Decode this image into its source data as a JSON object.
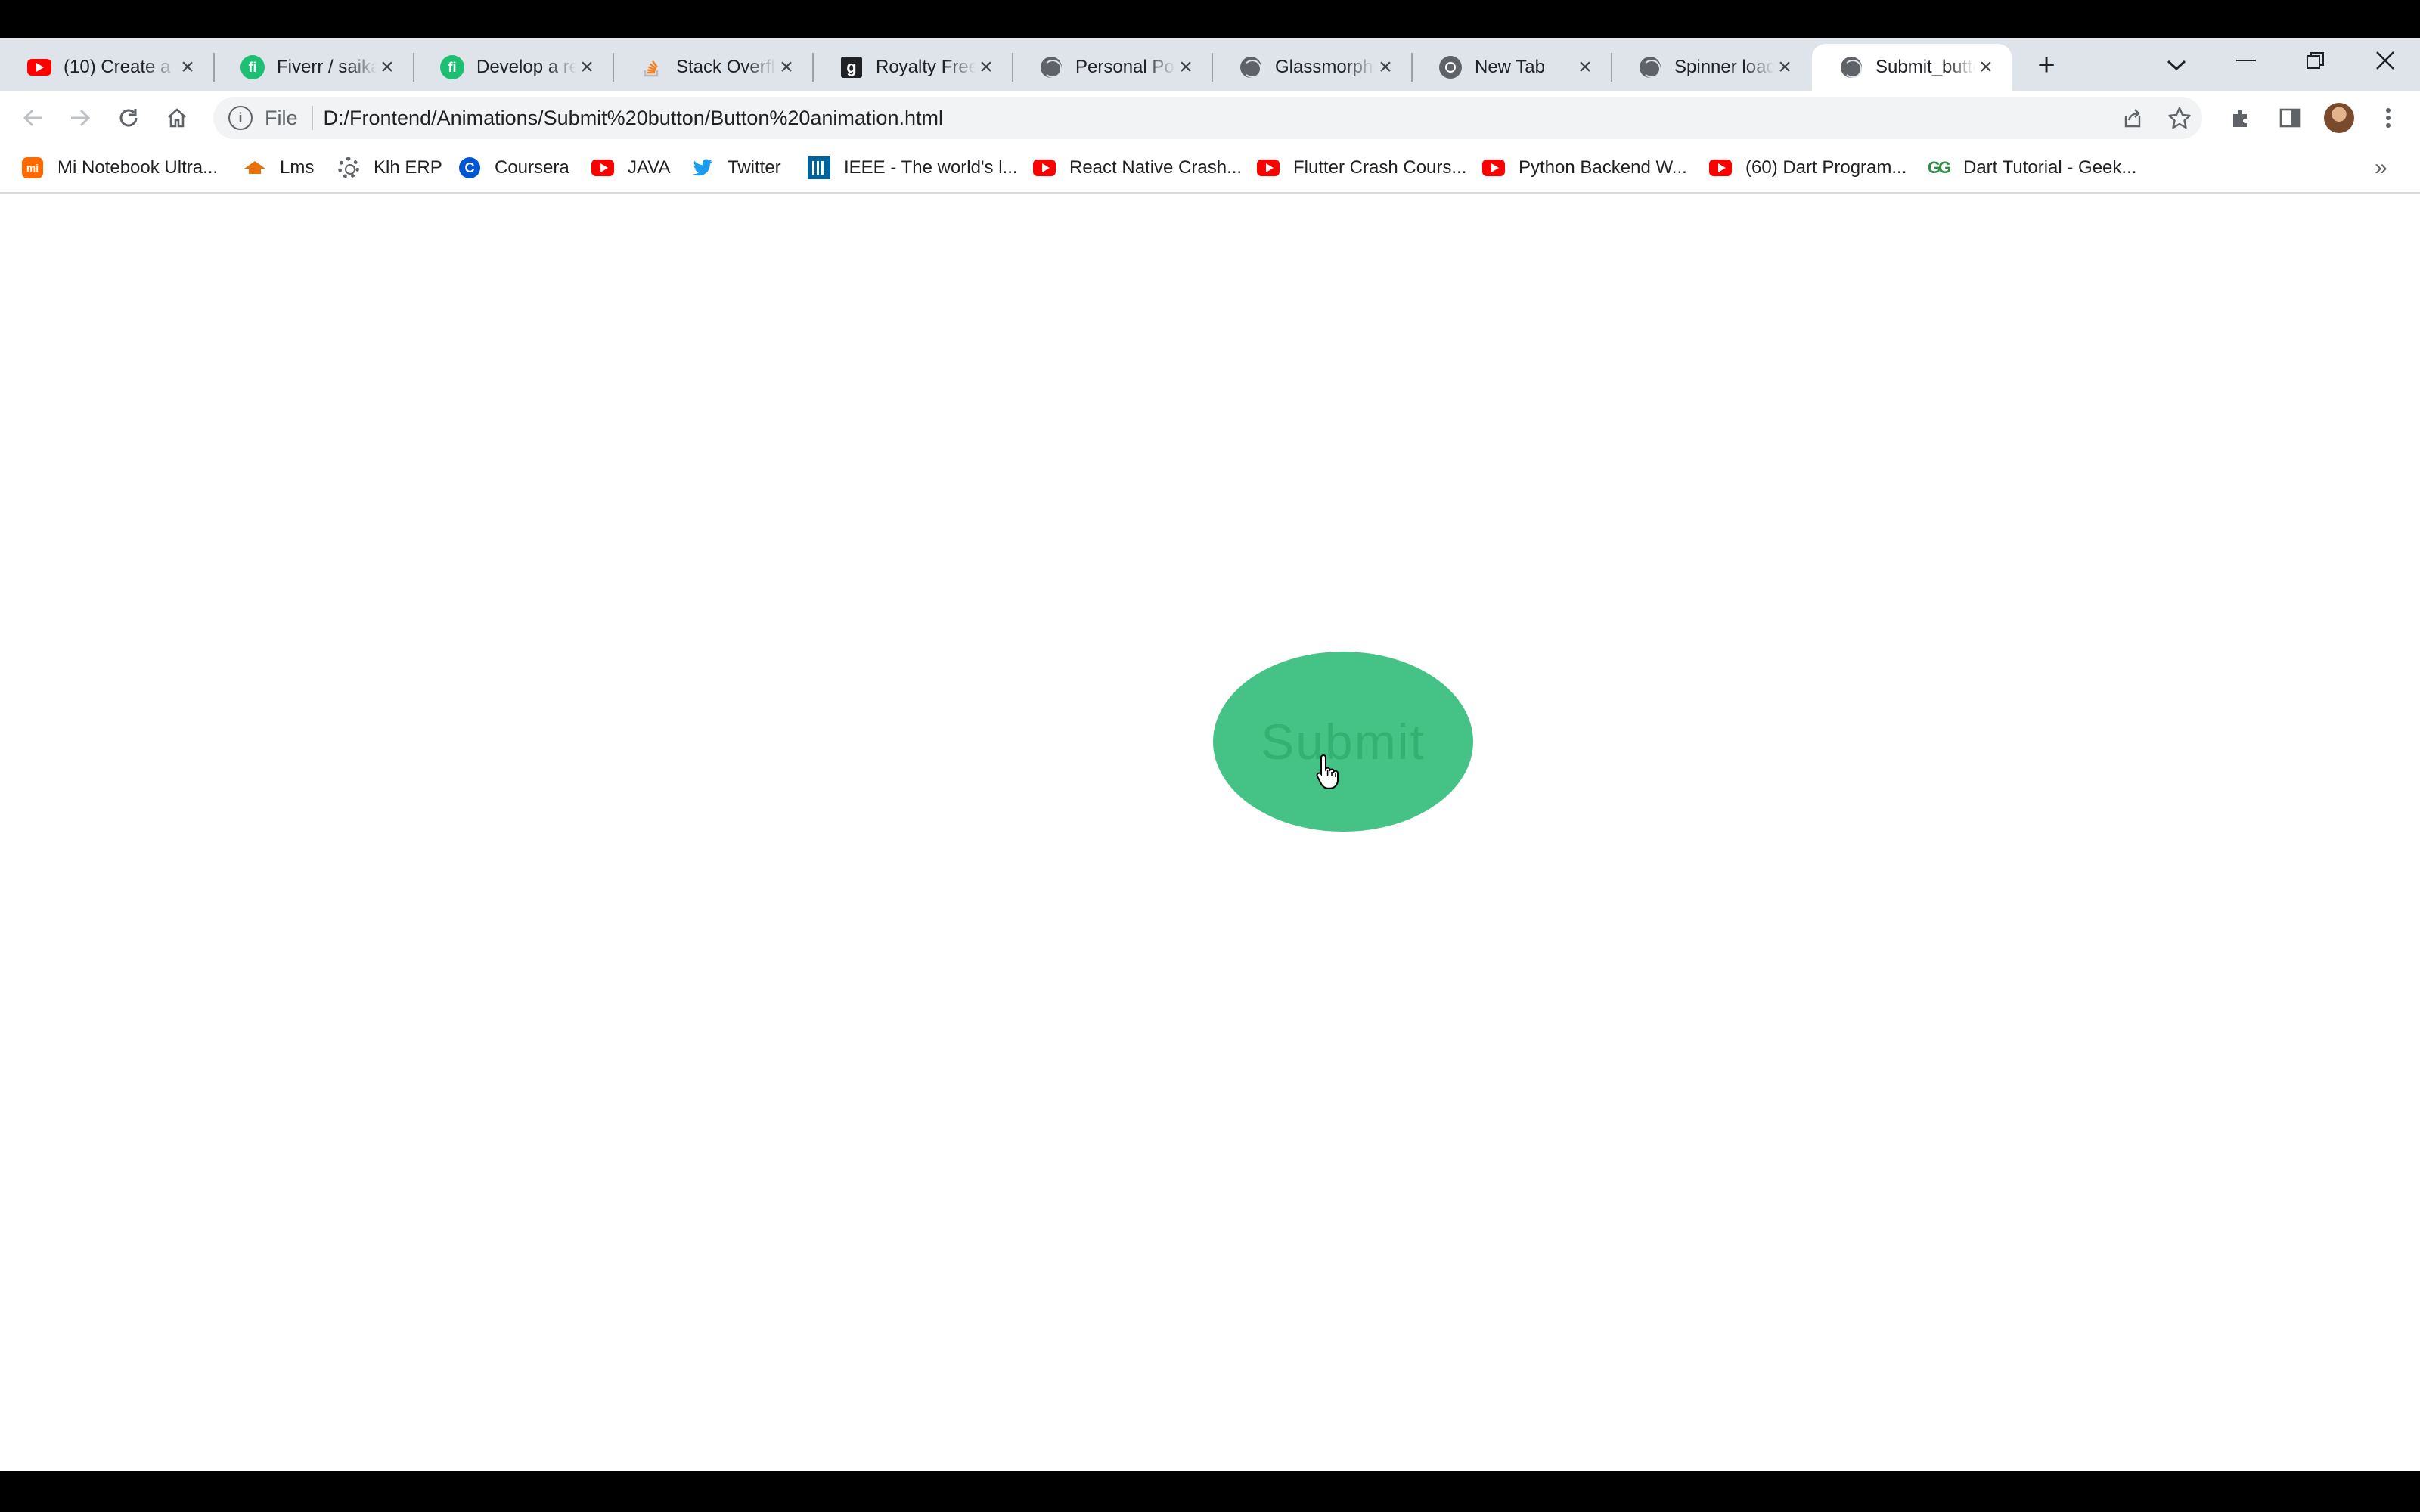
{
  "browser": {
    "tabs": [
      {
        "title": "(10) Create a",
        "icon": "youtube-icon",
        "active": false
      },
      {
        "title": "Fiverr / saikal",
        "icon": "fiverr-icon",
        "active": false
      },
      {
        "title": "Develop a re",
        "icon": "fiverr-icon",
        "active": false
      },
      {
        "title": "Stack Overflo",
        "icon": "stackoverflow-icon",
        "active": false
      },
      {
        "title": "Royalty Free",
        "icon": "getty-icon",
        "active": false
      },
      {
        "title": "Personal Por",
        "icon": "globe-icon",
        "active": false
      },
      {
        "title": "Glassmorphis",
        "icon": "globe-icon",
        "active": false
      },
      {
        "title": "New Tab",
        "icon": "chrome-icon",
        "active": false
      },
      {
        "title": "Spinner load",
        "icon": "globe-icon",
        "active": false
      },
      {
        "title": "Submit_butto",
        "icon": "globe-icon",
        "active": true
      }
    ],
    "new_tab_label": "+",
    "address": {
      "scheme_label": "File",
      "url": "D:/Frontend/Animations/Submit%20button/Button%20animation.html"
    },
    "bookmarks": [
      {
        "label": "Mi Notebook Ultra...",
        "icon": "mi-icon"
      },
      {
        "label": "Lms",
        "icon": "graduation-cap-icon"
      },
      {
        "label": "Klh ERP",
        "icon": "gear-icon"
      },
      {
        "label": "Coursera",
        "icon": "coursera-icon"
      },
      {
        "label": "JAVA",
        "icon": "youtube-icon"
      },
      {
        "label": "Twitter",
        "icon": "twitter-icon"
      },
      {
        "label": "IEEE - The world's l...",
        "icon": "ieee-icon"
      },
      {
        "label": "React Native Crash...",
        "icon": "youtube-icon"
      },
      {
        "label": "Flutter Crash Cours...",
        "icon": "youtube-icon"
      },
      {
        "label": "Python Backend W...",
        "icon": "youtube-icon"
      },
      {
        "label": "(60) Dart Program...",
        "icon": "youtube-icon"
      },
      {
        "label": "Dart Tutorial - Geek...",
        "icon": "geeksforgeeks-icon"
      }
    ],
    "bookmarks_overflow": "»"
  },
  "page": {
    "submit_button": {
      "label": "Submit",
      "color": "#45c386"
    }
  },
  "colors": {
    "tab_strip": "#dfe3ea",
    "toolbar": "#ffffff",
    "omnibox": "#f1f3f4",
    "accent_green": "#45c386"
  }
}
